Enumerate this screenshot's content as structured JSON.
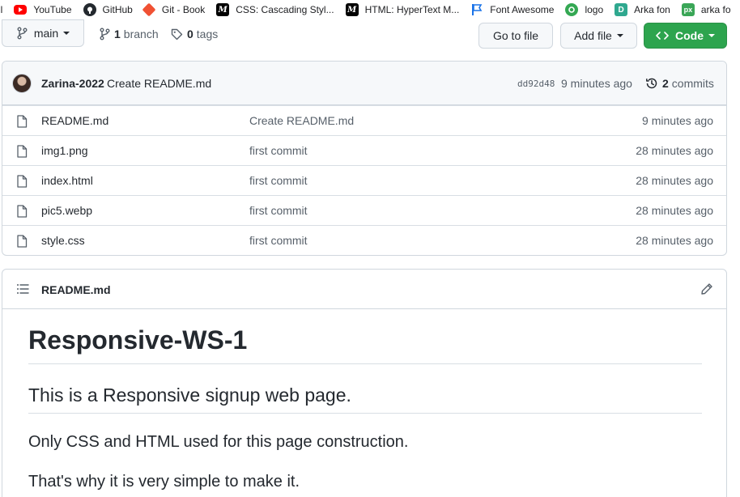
{
  "bookmarks": [
    {
      "label": "il",
      "icon": "cut-off-icon",
      "color": "#5f6368"
    },
    {
      "label": "YouTube",
      "icon": "youtube-icon",
      "color": "#ff0000"
    },
    {
      "label": "GitHub",
      "icon": "github-icon",
      "color": "#24292f"
    },
    {
      "label": "Git - Book",
      "icon": "git-icon",
      "color": "#f05133"
    },
    {
      "label": "CSS: Cascading Styl...",
      "icon": "mdn-icon",
      "color": "#000000"
    },
    {
      "label": "HTML: HyperText M...",
      "icon": "mdn-icon",
      "color": "#000000"
    },
    {
      "label": "Font Awesome",
      "icon": "flag-icon",
      "color": "#1a73e8"
    },
    {
      "label": "logo",
      "icon": "logo-icon",
      "color": "#34a853"
    },
    {
      "label": "Arka fon",
      "icon": "arka-icon",
      "color": "#2fa88f"
    },
    {
      "label": "arka fo",
      "icon": "px-icon",
      "color": "#3aa657"
    }
  ],
  "toolbar": {
    "branch_label": "main",
    "branch_count": "1",
    "branch_word": "branch",
    "tags_count": "0",
    "tags_word": "tags",
    "goto_label": "Go to file",
    "add_label": "Add file",
    "code_label": "Code",
    "code_color": "#2da44e"
  },
  "commit": {
    "author": "Zarina-2022",
    "message": "Create README.md",
    "sha": "dd92d48",
    "time": "9 minutes ago",
    "count": "2",
    "count_word": "commits"
  },
  "files": [
    {
      "name": "README.md",
      "commit": "Create README.md",
      "age": "9 minutes ago"
    },
    {
      "name": "img1.png",
      "commit": "first commit",
      "age": "28 minutes ago"
    },
    {
      "name": "index.html",
      "commit": "first commit",
      "age": "28 minutes ago"
    },
    {
      "name": "pic5.webp",
      "commit": "first commit",
      "age": "28 minutes ago"
    },
    {
      "name": "style.css",
      "commit": "first commit",
      "age": "28 minutes ago"
    }
  ],
  "readme": {
    "title": "README.md",
    "h1": "Responsive-WS-1",
    "h2": "This is a Responsive signup web page.",
    "p1": "Only CSS and HTML used for this page construction.",
    "p2": "That's why it is very simple to make it."
  }
}
